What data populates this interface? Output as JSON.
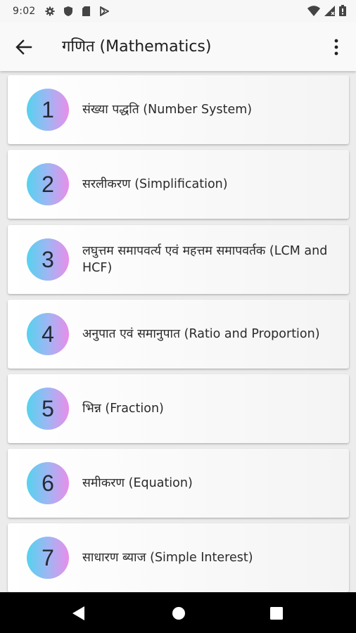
{
  "status_bar": {
    "time": "9:02",
    "left_icons": [
      "gear-icon",
      "shield-icon",
      "sd-card-icon",
      "play-store-icon"
    ],
    "right_icons": [
      "wifi-icon",
      "cell-signal-icon",
      "battery-icon"
    ]
  },
  "app_bar": {
    "title": "गणित (Mathematics)",
    "back_icon": "arrow-left-icon",
    "menu_icon": "more-vert-icon"
  },
  "topics": [
    {
      "number": "1",
      "title": "संख्या पद्धति (Number System)"
    },
    {
      "number": "2",
      "title": "सरलीकरण (Simplification)"
    },
    {
      "number": "3",
      "title": "लघुत्तम समापवर्त्य एवं महत्तम समापवर्तक (LCM and HCF)"
    },
    {
      "number": "4",
      "title": "अनुपात एवं समानुपात (Ratio and Proportion)"
    },
    {
      "number": "5",
      "title": "भिन्न (Fraction)"
    },
    {
      "number": "6",
      "title": "समीकरण (Equation)"
    },
    {
      "number": "7",
      "title": "साधारण ब्याज (Simple Interest)"
    }
  ],
  "nav_bar": {
    "icons": [
      "back-triangle-icon",
      "home-circle-icon",
      "recents-square-icon"
    ]
  },
  "colors": {
    "badge_gradient": [
      "#55d2ee",
      "#9fb6f3",
      "#e88ee9"
    ],
    "nav_bar_background": "#000000",
    "app_bar_background": "#f9f9f9"
  }
}
